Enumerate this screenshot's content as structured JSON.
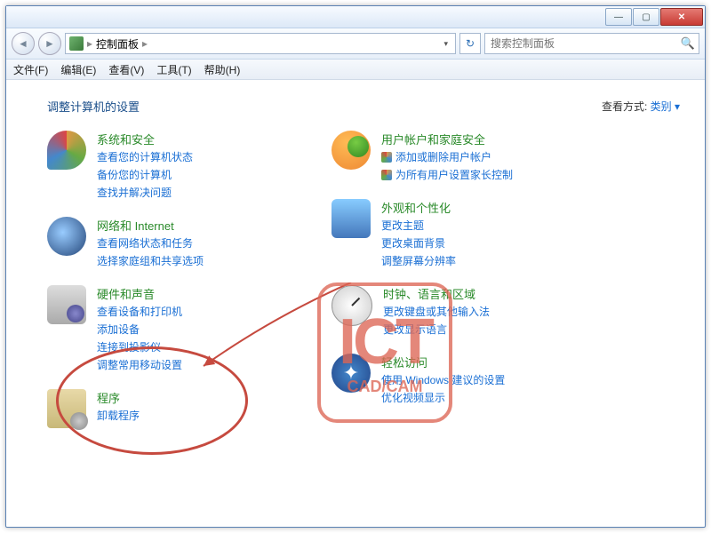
{
  "titlebar": {
    "min": "—",
    "max": "▢",
    "close": "✕"
  },
  "nav": {
    "back": "◄",
    "forward": "►",
    "breadcrumb_root_sep": "▸",
    "breadcrumb": "控制面板",
    "breadcrumb_sep": "▸",
    "dropdown": "▾",
    "refresh": "↻"
  },
  "search": {
    "placeholder": "搜索控制面板"
  },
  "menu": {
    "file": "文件(F)",
    "edit": "编辑(E)",
    "view": "查看(V)",
    "tools": "工具(T)",
    "help": "帮助(H)"
  },
  "header": {
    "title": "调整计算机的设置",
    "viewmode_label": "查看方式:",
    "viewmode_value": "类别 ▾"
  },
  "left": [
    {
      "title": "系统和安全",
      "links": [
        "查看您的计算机状态",
        "备份您的计算机",
        "查找并解决问题"
      ]
    },
    {
      "title": "网络和 Internet",
      "links": [
        "查看网络状态和任务",
        "选择家庭组和共享选项"
      ]
    },
    {
      "title": "硬件和声音",
      "links": [
        "查看设备和打印机",
        "添加设备",
        "连接到投影仪",
        "调整常用移动设置"
      ]
    },
    {
      "title": "程序",
      "links": [
        "卸载程序"
      ]
    }
  ],
  "right": [
    {
      "title": "用户帐户和家庭安全",
      "shielded_links": [
        "添加或删除用户帐户",
        "为所有用户设置家长控制"
      ]
    },
    {
      "title": "外观和个性化",
      "links": [
        "更改主题",
        "更改桌面背景",
        "调整屏幕分辨率"
      ]
    },
    {
      "title": "时钟、语言和区域",
      "links": [
        "更改键盘或其他输入法",
        "更改显示语言"
      ]
    },
    {
      "title": "轻松访问",
      "links": [
        "使用 Windows 建议的设置",
        "优化视频显示"
      ]
    }
  ],
  "watermark": {
    "big": "ICT",
    "small": "CAD/CAM"
  }
}
